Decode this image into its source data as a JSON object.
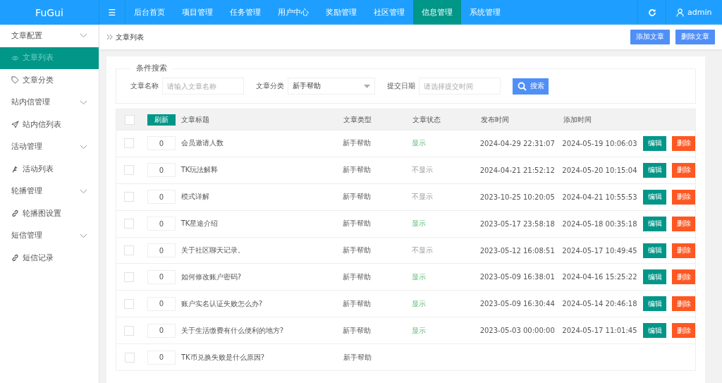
{
  "logo": "FuGui",
  "menu_icon": "☰",
  "top_nav": [
    {
      "label": "后台首页",
      "selected": false
    },
    {
      "label": "项目管理",
      "selected": false
    },
    {
      "label": "任务管理",
      "selected": false
    },
    {
      "label": "用户中心",
      "selected": false
    },
    {
      "label": "奖励管理",
      "selected": false
    },
    {
      "label": "社区管理",
      "selected": false
    },
    {
      "label": "信息管理",
      "selected": true
    },
    {
      "label": "系统管理",
      "selected": false
    }
  ],
  "user": "admin",
  "sidebar": [
    {
      "kind": "group",
      "label": "文章配置",
      "selected": false
    },
    {
      "kind": "item",
      "label": "文章列表",
      "selected": true
    },
    {
      "kind": "item",
      "label": "文章分类",
      "selected": false
    },
    {
      "kind": "group",
      "label": "站内信管理",
      "selected": false
    },
    {
      "kind": "item",
      "label": "站内信列表",
      "selected": false
    },
    {
      "kind": "group",
      "label": "活动管理",
      "selected": false
    },
    {
      "kind": "item",
      "label": "活动列表",
      "selected": false
    },
    {
      "kind": "group",
      "label": "轮播管理",
      "selected": false
    },
    {
      "kind": "item",
      "label": "轮播图设置",
      "selected": false
    },
    {
      "kind": "group",
      "label": "短信管理",
      "selected": false
    },
    {
      "kind": "item",
      "label": "短信记录",
      "selected": false
    }
  ],
  "breadcrumb": "文章列表",
  "header_buttons": [
    "添加文章",
    "删除文章"
  ],
  "search": {
    "legend": "条件搜索",
    "name_label": "文章名称",
    "name_placeholder": "请输入文章名称",
    "category_label": "文章分类",
    "category_value": "新手帮助",
    "date_label": "提交日期",
    "date_placeholder": "请选择提交时间",
    "button": "搜索"
  },
  "table": {
    "select_all_checked": false,
    "refresh_button": "刷新",
    "columns": [
      "文章标题",
      "文章类型",
      "文章状态",
      "发布时间",
      "添加时间"
    ],
    "rows": [
      {
        "sort": "0",
        "title": "会员邀请人数",
        "type": "新手帮助",
        "status": "显示",
        "shown": true,
        "published": "2024-04-29 22:31:07",
        "added": "2024-05-19 10:06:03",
        "edit": "编辑",
        "delete": "删除",
        "checked": false
      },
      {
        "sort": "0",
        "title": "TK玩法解释",
        "type": "新手帮助",
        "status": "不显示",
        "shown": false,
        "published": "2024-04-21 21:52:12",
        "added": "2024-05-20 10:15:04",
        "edit": "编辑",
        "delete": "删除",
        "checked": false
      },
      {
        "sort": "0",
        "title": "模式详解",
        "type": "新手帮助",
        "status": "不显示",
        "shown": false,
        "published": "2023-10-25 10:20:05",
        "added": "2024-04-21 10:55:53",
        "edit": "编辑",
        "delete": "删除",
        "checked": false
      },
      {
        "sort": "0",
        "title": "TK星途介绍",
        "type": "新手帮助",
        "status": "显示",
        "shown": true,
        "published": "2023-05-17 23:58:18",
        "added": "2024-05-18 00:35:18",
        "edit": "编辑",
        "delete": "删除",
        "checked": false
      },
      {
        "sort": "0",
        "title": "关于社区聊天记录。",
        "type": "新手帮助",
        "status": "不显示",
        "shown": false,
        "published": "2023-05-12 16:08:51",
        "added": "2024-05-17 10:49:45",
        "edit": "编辑",
        "delete": "删除",
        "checked": false
      },
      {
        "sort": "0",
        "title": "如何修改账户密码?",
        "type": "新手帮助",
        "status": "显示",
        "shown": true,
        "published": "2023-05-09 16:38:01",
        "added": "2024-04-16 15:25:22",
        "edit": "编辑",
        "delete": "删除",
        "checked": false
      },
      {
        "sort": "0",
        "title": "账户实名认证失败怎么办?",
        "type": "新手帮助",
        "status": "显示",
        "shown": true,
        "published": "2023-05-09 16:30:44",
        "added": "2024-05-14 20:46:18",
        "edit": "编辑",
        "delete": "删除",
        "checked": false
      },
      {
        "sort": "0",
        "title": "关于生活缴费有什么便利的地方?",
        "type": "新手帮助",
        "status": "显示",
        "shown": true,
        "published": "2023-05-03 00:00:00",
        "added": "2024-05-17 11:01:45",
        "edit": "编辑",
        "delete": "删除",
        "checked": false
      },
      {
        "sort": "0",
        "title": "TK币兑换失败是什么原因?",
        "type": "新手帮助",
        "checked": false
      }
    ]
  }
}
